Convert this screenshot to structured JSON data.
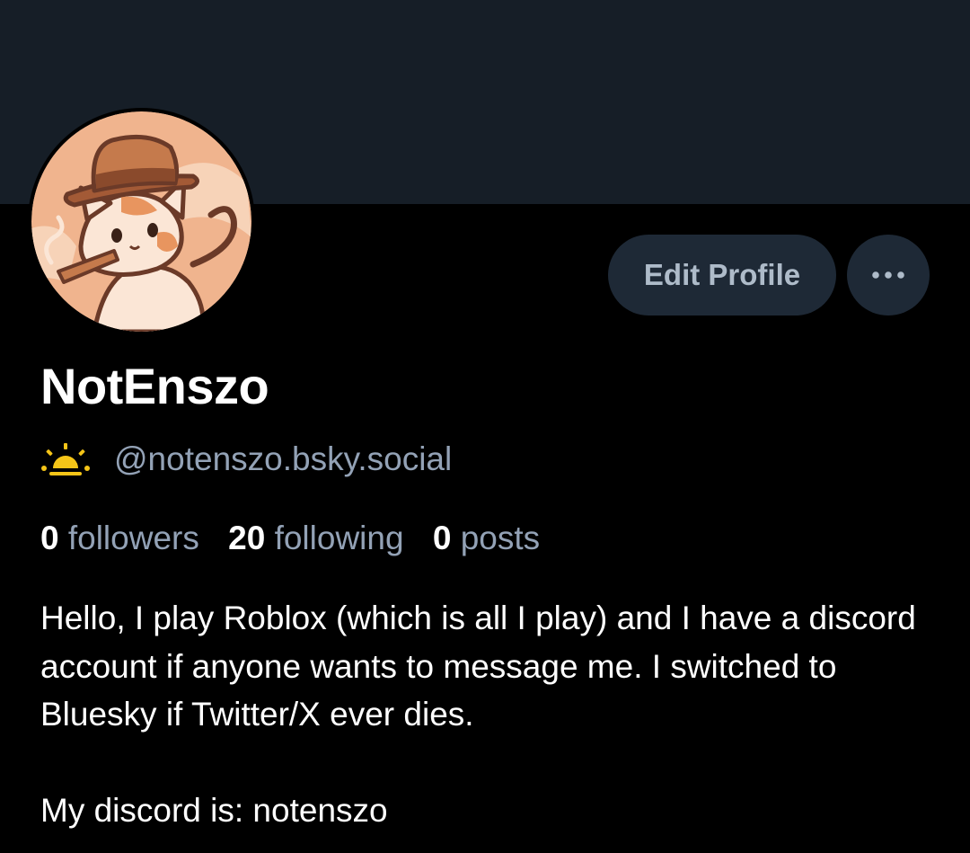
{
  "profile": {
    "display_name": "NotEnszo",
    "handle": "@notenszo.bsky.social",
    "handle_icon": "sun-icon",
    "avatar": "cat-with-hat-avatar"
  },
  "actions": {
    "edit_label": "Edit Profile",
    "more_icon": "more-dots-icon"
  },
  "stats": {
    "followers_count": "0",
    "followers_label": "followers",
    "following_count": "20",
    "following_label": "following",
    "posts_count": "0",
    "posts_label": "posts"
  },
  "bio": {
    "line1": "Hello, I play Roblox (which is all I play) and I have a discord account if anyone wants to message me. I switched to Bluesky if Twitter/X ever dies.",
    "line2": "My discord is: notenszo"
  },
  "colors": {
    "banner": "#161e27",
    "background": "#000000",
    "button_bg": "#1e2936",
    "muted_text": "#93a2b6",
    "sun_icon": "#f5c518"
  }
}
